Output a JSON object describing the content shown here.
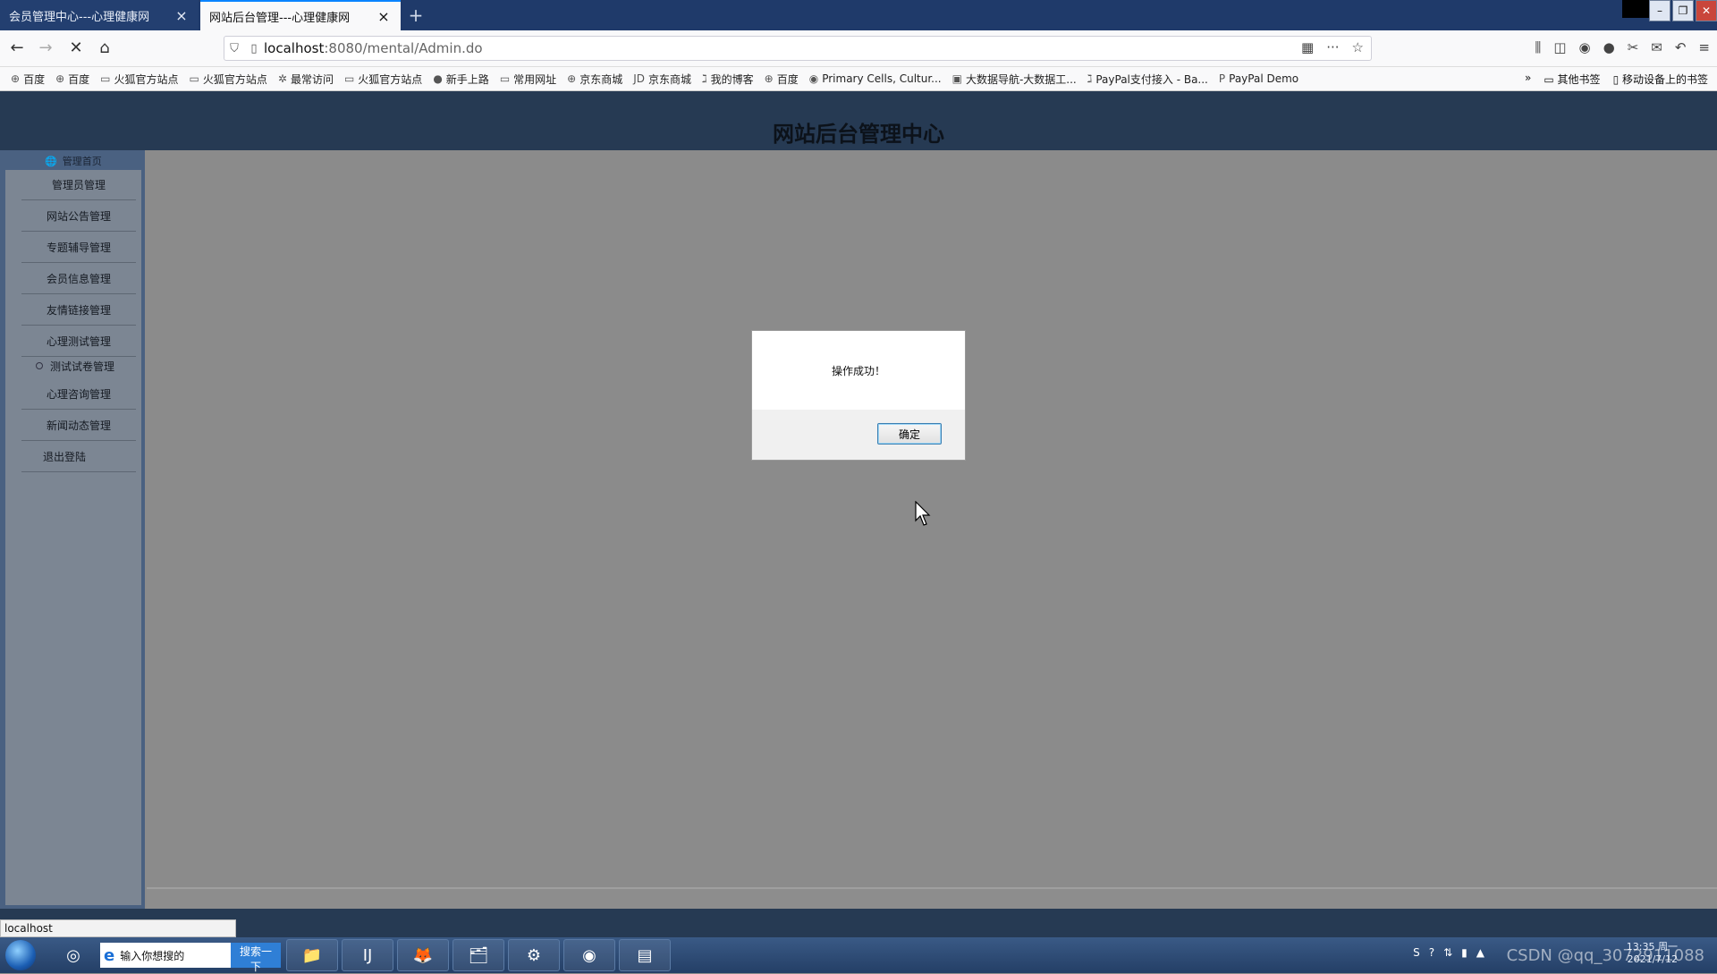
{
  "browser": {
    "tabs": [
      {
        "title": "会员管理中心---心理健康网",
        "active": false
      },
      {
        "title": "网站后台管理---心理健康网",
        "active": true
      }
    ],
    "url_host": "localhost",
    "url_rest": ":8080/mental/Admin.do",
    "bookmarks": [
      {
        "icon": "globe-icon",
        "label": "百度"
      },
      {
        "icon": "globe-icon",
        "label": "百度"
      },
      {
        "icon": "folder-icon",
        "label": "火狐官方站点"
      },
      {
        "icon": "folder-icon",
        "label": "火狐官方站点"
      },
      {
        "icon": "gear-icon",
        "label": "最常访问"
      },
      {
        "icon": "folder-icon",
        "label": "火狐官方站点"
      },
      {
        "icon": "firefox-icon",
        "label": "新手上路"
      },
      {
        "icon": "folder-icon",
        "label": "常用网址"
      },
      {
        "icon": "globe-icon",
        "label": "京东商城"
      },
      {
        "icon": "jd-icon",
        "label": "京东商城"
      },
      {
        "icon": "blog-icon",
        "label": "我的博客"
      },
      {
        "icon": "globe-icon",
        "label": "百度"
      },
      {
        "icon": "primary-cells-icon",
        "label": "Primary Cells, Cultur..."
      },
      {
        "icon": "bigdata-icon",
        "label": "大数据导航-大数据工..."
      },
      {
        "icon": "blog-icon",
        "label": "PayPal支付接入 - Ba..."
      },
      {
        "icon": "paypal-icon",
        "label": "PayPal Demo"
      }
    ],
    "bookmarks_more": "其他书签",
    "bookmarks_mobile": "移动设备上的书签",
    "status_url": "localhost"
  },
  "page": {
    "title": "网站后台管理中心",
    "sidebar": {
      "home": "管理首页",
      "items": [
        {
          "label": "管理员管理"
        },
        {
          "label": "网站公告管理"
        },
        {
          "label": "专题辅导管理"
        },
        {
          "label": "会员信息管理"
        },
        {
          "label": "友情链接管理"
        },
        {
          "label": "心理测试管理"
        },
        {
          "label": "测试试卷管理"
        },
        {
          "label": "心理咨询管理"
        },
        {
          "label": "新闻动态管理"
        },
        {
          "label": "退出登陆"
        }
      ]
    }
  },
  "dialog": {
    "message": "操作成功！",
    "ok_label": "确定"
  },
  "taskbar": {
    "search_placeholder": "输入你想搜的",
    "search_button": "搜索一下",
    "clock_time": "13:35 周一",
    "clock_date": "2021/7/12",
    "watermark": "CSDN @qq_3072911088"
  }
}
